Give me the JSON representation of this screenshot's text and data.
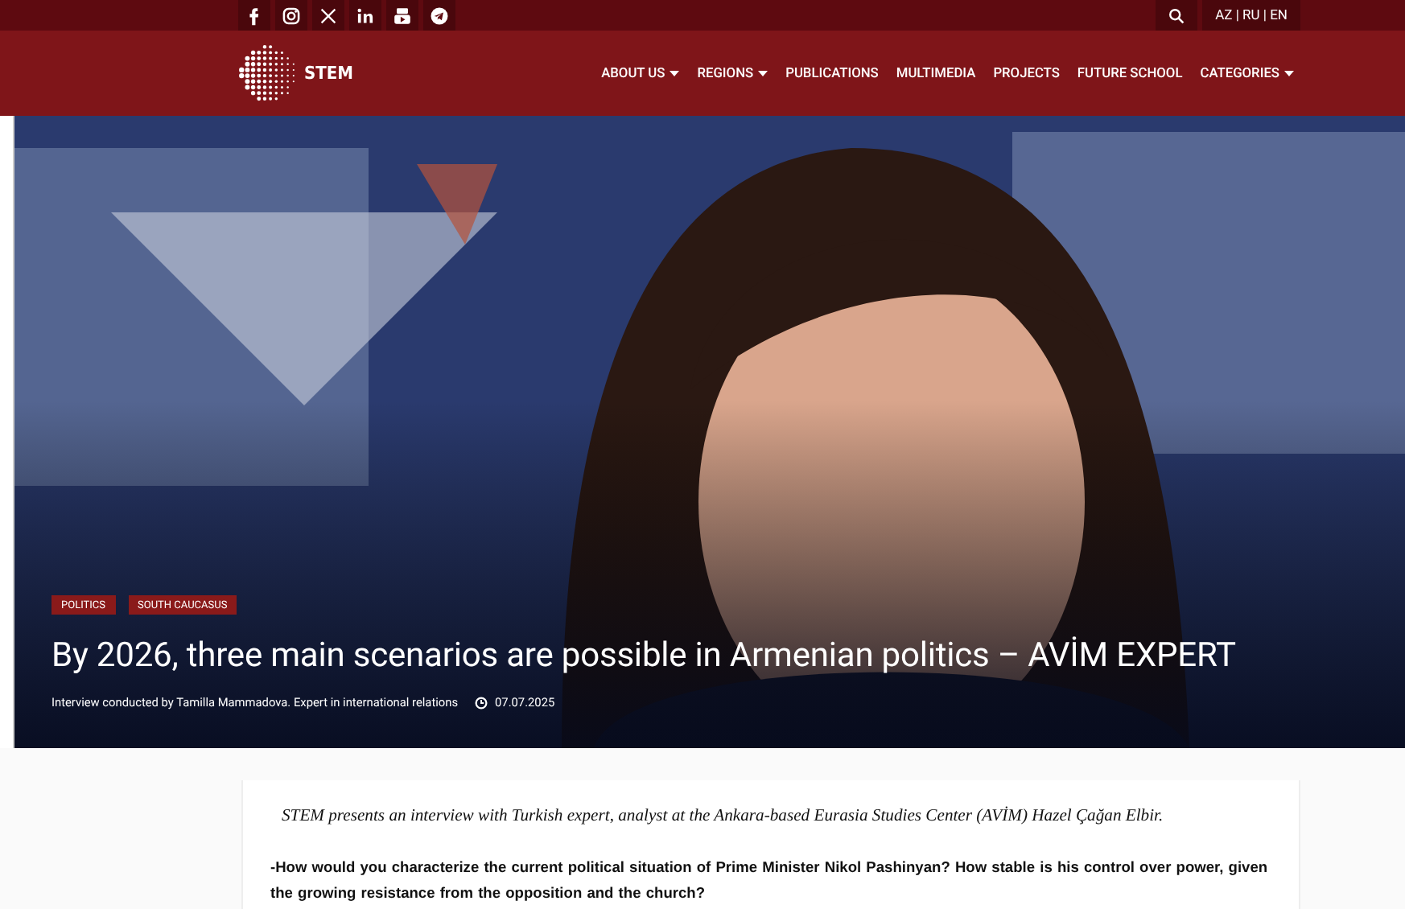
{
  "language_switch": "AZ | RU | EN",
  "logo": {
    "text": "STEM"
  },
  "nav": [
    {
      "label": "ABOUT US",
      "dropdown": true
    },
    {
      "label": "REGIONS",
      "dropdown": true
    },
    {
      "label": "PUBLICATIONS",
      "dropdown": false
    },
    {
      "label": "MULTIMEDIA",
      "dropdown": false
    },
    {
      "label": "PROJECTS",
      "dropdown": false
    },
    {
      "label": "FUTURE SCHOOL",
      "dropdown": false
    },
    {
      "label": "CATEGORIES",
      "dropdown": true
    }
  ],
  "hero": {
    "tags": [
      "POLITICS",
      "SOUTH CAUCASUS"
    ],
    "title": "By 2026, three main scenarios are possible in Armenian politics – AVİM EXPERT",
    "byline": "Interview conducted by Tamilla Mammadova. Expert in international relations",
    "date": "07.07.2025"
  },
  "article": {
    "intro": "STEM presents an interview with Turkish expert, analyst at the Ankara-based Eurasia Studies Center (AVİM) Hazel Çağan Elbir.",
    "question": "-How would you characterize the current political situation of Prime Minister Nikol Pashinyan? How stable is his control over power, given the growing resistance from the opposition and the church?"
  }
}
